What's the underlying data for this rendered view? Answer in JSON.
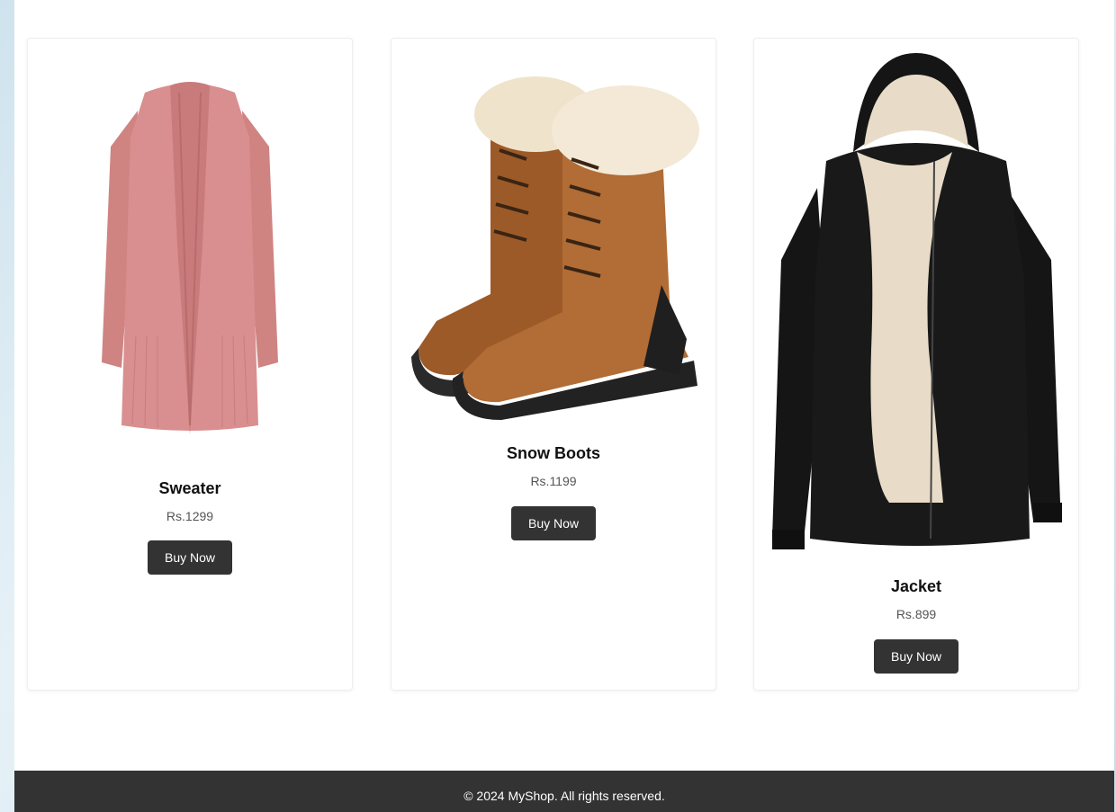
{
  "products": [
    {
      "name": "Sweater",
      "price": "Rs.1299",
      "button_label": "Buy Now",
      "image_icon": "sweater-image"
    },
    {
      "name": "Snow Boots",
      "price": "Rs.1199",
      "button_label": "Buy Now",
      "image_icon": "snow-boots-image"
    },
    {
      "name": "Jacket",
      "price": "Rs.899",
      "button_label": "Buy Now",
      "image_icon": "jacket-image"
    }
  ],
  "footer": {
    "text": "© 2024 MyShop. All rights reserved."
  },
  "colors": {
    "button_bg": "#333333",
    "footer_bg": "#333333",
    "sweater": "#d98f8f",
    "boots": "#a9652e",
    "jacket": "#151515",
    "lining": "#e8dcc8"
  }
}
